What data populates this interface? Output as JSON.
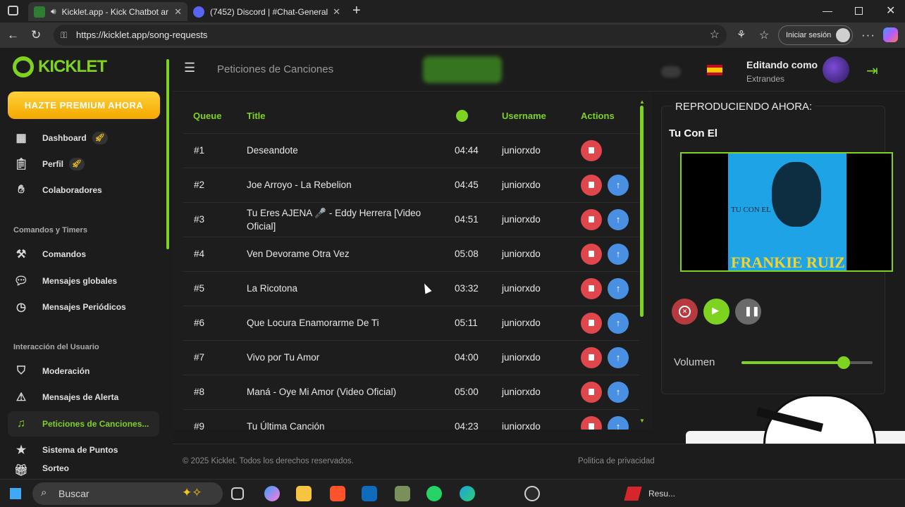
{
  "browser": {
    "tabs": [
      {
        "title": "Kicklet.app - Kick Chatbot ar"
      },
      {
        "title": "(7452) Discord | #Chat-General"
      }
    ],
    "url": "https://kicklet.app/song-requests",
    "signin_label": "Iniciar sesión"
  },
  "sidebar": {
    "logo": "KICKLET",
    "premium_label": "HAZTE PREMIUM AHORA",
    "items_top": [
      "Dashboard",
      "Perfil",
      "Colaboradores"
    ],
    "section_commands": "Comandos y Timers",
    "items_commands": [
      "Comandos",
      "Mensajes globales",
      "Mensajes Periódicos"
    ],
    "section_interaction": "Interacción del Usuario",
    "items_interaction": [
      "Moderación",
      "Mensajes de Alerta",
      "Peticiones de Canciones...",
      "Sistema de Puntos",
      "Sorteo"
    ]
  },
  "header": {
    "page_title": "Peticiones de Canciones",
    "editing_as": "Editando como",
    "username": "Extrandes"
  },
  "table": {
    "headers": {
      "queue": "Queue",
      "title": "Title",
      "username": "Username",
      "actions": "Actions"
    },
    "rows": [
      {
        "queue": "#1",
        "title": "Deseandote",
        "duration": "04:44",
        "user": "juniorxdo"
      },
      {
        "queue": "#2",
        "title": "Joe Arroyo - La Rebelion",
        "duration": "04:45",
        "user": "juniorxdo"
      },
      {
        "queue": "#3",
        "title": "Tu Eres AJENA 🎤 - Eddy Herrera [Video Oficial]",
        "duration": "04:51",
        "user": "juniorxdo"
      },
      {
        "queue": "#4",
        "title": "Ven Devorame Otra Vez",
        "duration": "05:08",
        "user": "juniorxdo"
      },
      {
        "queue": "#5",
        "title": "La Ricotona",
        "duration": "03:32",
        "user": "juniorxdo"
      },
      {
        "queue": "#6",
        "title": "Que Locura Enamorarme De Ti",
        "duration": "05:11",
        "user": "juniorxdo"
      },
      {
        "queue": "#7",
        "title": "Vivo por Tu Amor",
        "duration": "04:00",
        "user": "juniorxdo"
      },
      {
        "queue": "#8",
        "title": "Maná - Oye Mi Amor (Video Oficial)",
        "duration": "05:00",
        "user": "juniorxdo"
      },
      {
        "queue": "#9",
        "title": "Tu Última Canción",
        "duration": "04:23",
        "user": "juniorxdo"
      }
    ]
  },
  "player": {
    "heading": "REPRODUCIENDO AHORA:",
    "track": "Tu Con El",
    "cover_small_text": "TU CON EL",
    "cover_artist": "FRANKIE RUIZ",
    "volume_label": "Volumen",
    "volume_level": 0.78
  },
  "footer": {
    "copyright": "© 2025 Kicklet. Todos los derechos reservados.",
    "privacy": "Politica de privacidad"
  },
  "taskbar": {
    "search_placeholder": "Buscar",
    "tray_label": "Resu..."
  },
  "colors": {
    "accent": "#7ed321",
    "delete": "#e0474c",
    "move_up": "#4a90e2",
    "premium": "#f5b400"
  }
}
